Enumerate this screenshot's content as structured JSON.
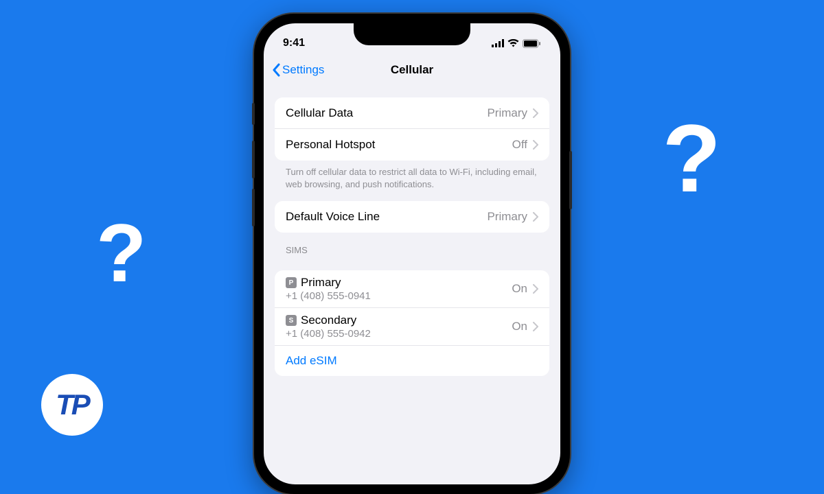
{
  "background": {
    "question_left": "?",
    "question_right": "?",
    "logo_text": "TP"
  },
  "status": {
    "time": "9:41"
  },
  "nav": {
    "back_label": "Settings",
    "title": "Cellular"
  },
  "group1": {
    "cellular_data": {
      "label": "Cellular Data",
      "value": "Primary"
    },
    "personal_hotspot": {
      "label": "Personal Hotspot",
      "value": "Off"
    },
    "footnote": "Turn off cellular data to restrict all data to Wi-Fi, including email, web browsing, and push notifications."
  },
  "group2": {
    "default_voice": {
      "label": "Default Voice Line",
      "value": "Primary"
    }
  },
  "sims": {
    "header": "SIMs",
    "items": [
      {
        "badge": "P",
        "name": "Primary",
        "number": "+1 (408) 555-0941",
        "status": "On"
      },
      {
        "badge": "S",
        "name": "Secondary",
        "number": "+1 (408) 555-0942",
        "status": "On"
      }
    ],
    "add_label": "Add eSIM"
  }
}
